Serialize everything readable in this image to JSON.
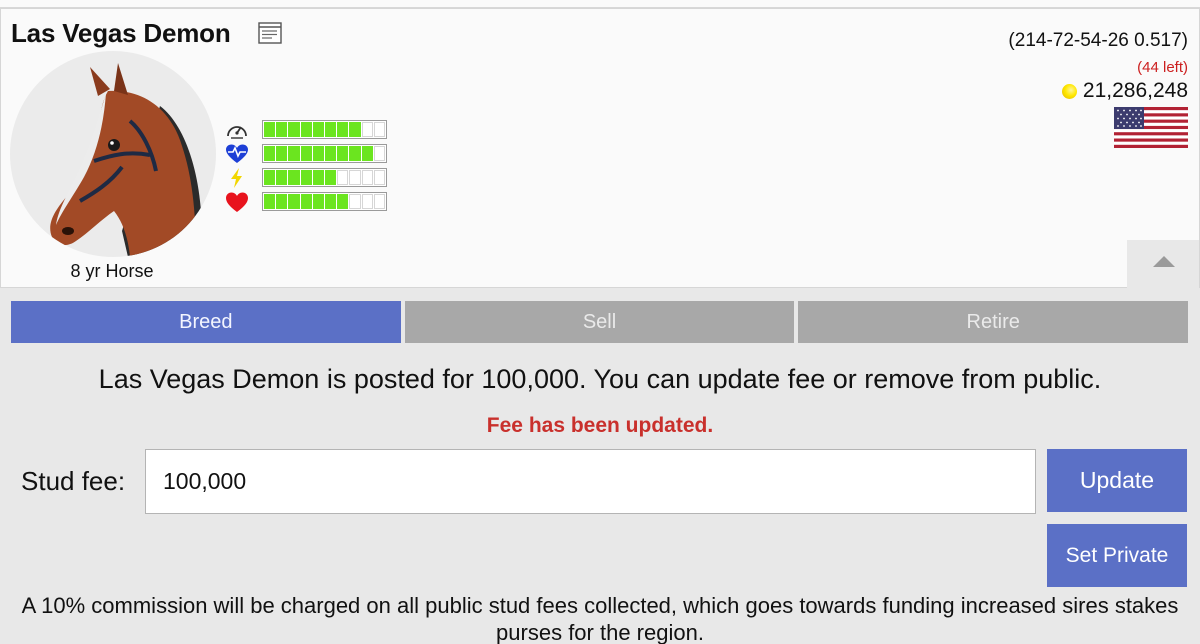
{
  "horse": {
    "name": "Las Vegas Demon",
    "age_label": "8 yr Horse",
    "code": "(214-72-54-26 0.517)",
    "left_count": "(44 left)",
    "coins": "21,286,248"
  },
  "stats": [
    {
      "icon": "speedometer-icon",
      "segments_filled": 8,
      "segments_total": 10
    },
    {
      "icon": "heart-pulse-icon",
      "segments_filled": 9,
      "segments_total": 10
    },
    {
      "icon": "lightning-icon",
      "segments_filled": 6,
      "segments_total": 10
    },
    {
      "icon": "heart-icon",
      "segments_filled": 7,
      "segments_total": 10
    }
  ],
  "tabs": [
    {
      "label": "Breed",
      "active": true
    },
    {
      "label": "Sell",
      "active": false
    },
    {
      "label": "Retire",
      "active": false
    }
  ],
  "breed": {
    "posted_message": "Las Vegas Demon is posted for 100,000. You can update fee or remove from public.",
    "fee_updated_message": "Fee has been updated.",
    "stud_fee_label": "Stud fee:",
    "stud_fee_value": "100,000",
    "update_label": "Update",
    "set_private_label": "Set Private",
    "commission_note": "A 10% commission will be charged on all public stud fees collected, which goes towards funding increased sires stakes purses for the region."
  },
  "colors": {
    "accent": "#5b70c6",
    "tab_inactive": "#a8a8a8",
    "stat_bar": "#6be51f",
    "alert_text": "#c9302c"
  }
}
